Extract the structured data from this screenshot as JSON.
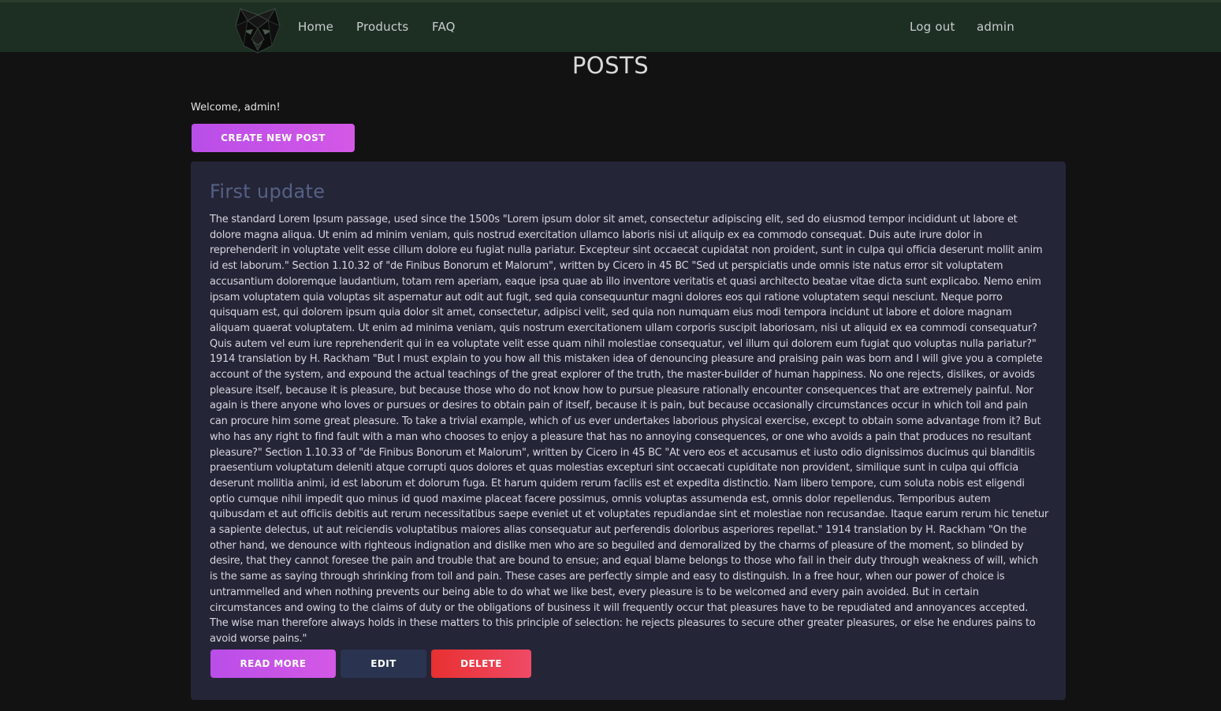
{
  "nav": {
    "logo_icon": "panther-head-logo-icon",
    "links": [
      "Home",
      "Products",
      "FAQ"
    ],
    "logout": "Log out",
    "user": "admin"
  },
  "page": {
    "title": "POSTS",
    "welcome": "Welcome, admin!",
    "create_button": "CREATE NEW POST"
  },
  "post": {
    "title": "First update",
    "body": "The standard Lorem Ipsum passage, used since the 1500s \"Lorem ipsum dolor sit amet, consectetur adipiscing elit, sed do eiusmod tempor incididunt ut labore et dolore magna aliqua. Ut enim ad minim veniam, quis nostrud exercitation ullamco laboris nisi ut aliquip ex ea commodo consequat. Duis aute irure dolor in reprehenderit in voluptate velit esse cillum dolore eu fugiat nulla pariatur. Excepteur sint occaecat cupidatat non proident, sunt in culpa qui officia deserunt mollit anim id est laborum.\" Section 1.10.32 of \"de Finibus Bonorum et Malorum\", written by Cicero in 45 BC \"Sed ut perspiciatis unde omnis iste natus error sit voluptatem accusantium doloremque laudantium, totam rem aperiam, eaque ipsa quae ab illo inventore veritatis et quasi architecto beatae vitae dicta sunt explicabo. Nemo enim ipsam voluptatem quia voluptas sit aspernatur aut odit aut fugit, sed quia consequuntur magni dolores eos qui ratione voluptatem sequi nesciunt. Neque porro quisquam est, qui dolorem ipsum quia dolor sit amet, consectetur, adipisci velit, sed quia non numquam eius modi tempora incidunt ut labore et dolore magnam aliquam quaerat voluptatem. Ut enim ad minima veniam, quis nostrum exercitationem ullam corporis suscipit laboriosam, nisi ut aliquid ex ea commodi consequatur? Quis autem vel eum iure reprehenderit qui in ea voluptate velit esse quam nihil molestiae consequatur, vel illum qui dolorem eum fugiat quo voluptas nulla pariatur?\" 1914 translation by H. Rackham \"But I must explain to you how all this mistaken idea of denouncing pleasure and praising pain was born and I will give you a complete account of the system, and expound the actual teachings of the great explorer of the truth, the master-builder of human happiness. No one rejects, dislikes, or avoids pleasure itself, because it is pleasure, but because those who do not know how to pursue pleasure rationally encounter consequences that are extremely painful. Nor again is there anyone who loves or pursues or desires to obtain pain of itself, because it is pain, but because occasionally circumstances occur in which toil and pain can procure him some great pleasure. To take a trivial example, which of us ever undertakes laborious physical exercise, except to obtain some advantage from it? But who has any right to find fault with a man who chooses to enjoy a pleasure that has no annoying consequences, or one who avoids a pain that produces no resultant pleasure?\" Section 1.10.33 of \"de Finibus Bonorum et Malorum\", written by Cicero in 45 BC \"At vero eos et accusamus et iusto odio dignissimos ducimus qui blanditiis praesentium voluptatum deleniti atque corrupti quos dolores et quas molestias excepturi sint occaecati cupiditate non provident, similique sunt in culpa qui officia deserunt mollitia animi, id est laborum et dolorum fuga. Et harum quidem rerum facilis est et expedita distinctio. Nam libero tempore, cum soluta nobis est eligendi optio cumque nihil impedit quo minus id quod maxime placeat facere possimus, omnis voluptas assumenda est, omnis dolor repellendus. Temporibus autem quibusdam et aut officiis debitis aut rerum necessitatibus saepe eveniet ut et voluptates repudiandae sint et molestiae non recusandae. Itaque earum rerum hic tenetur a sapiente delectus, ut aut reiciendis voluptatibus maiores alias consequatur aut perferendis doloribus asperiores repellat.\" 1914 translation by H. Rackham \"On the other hand, we denounce with righteous indignation and dislike men who are so beguiled and demoralized by the charms of pleasure of the moment, so blinded by desire, that they cannot foresee the pain and trouble that are bound to ensue; and equal blame belongs to those who fail in their duty through weakness of will, which is the same as saying through shrinking from toil and pain. These cases are perfectly simple and easy to distinguish. In a free hour, when our power of choice is untrammelled and when nothing prevents our being able to do what we like best, every pleasure is to be welcomed and every pain avoided. But in certain circumstances and owing to the claims of duty or the obligations of business it will frequently occur that pleasures have to be repudiated and annoyances accepted. The wise man therefore always holds in these matters to this principle of selection: he rejects pleasures to secure other greater pleasures, or else he endures pains to avoid worse pains.\"",
    "actions": {
      "read_more": "READ MORE",
      "edit": "EDIT",
      "delete": "DELETE"
    }
  },
  "colors": {
    "navbar": "#1d2f22",
    "background": "#121212",
    "card": "#252538",
    "accent_purple": "#c552e7",
    "danger_red": "#ee3b4b",
    "edit_navy": "#2a3450",
    "post_title": "#556185"
  }
}
